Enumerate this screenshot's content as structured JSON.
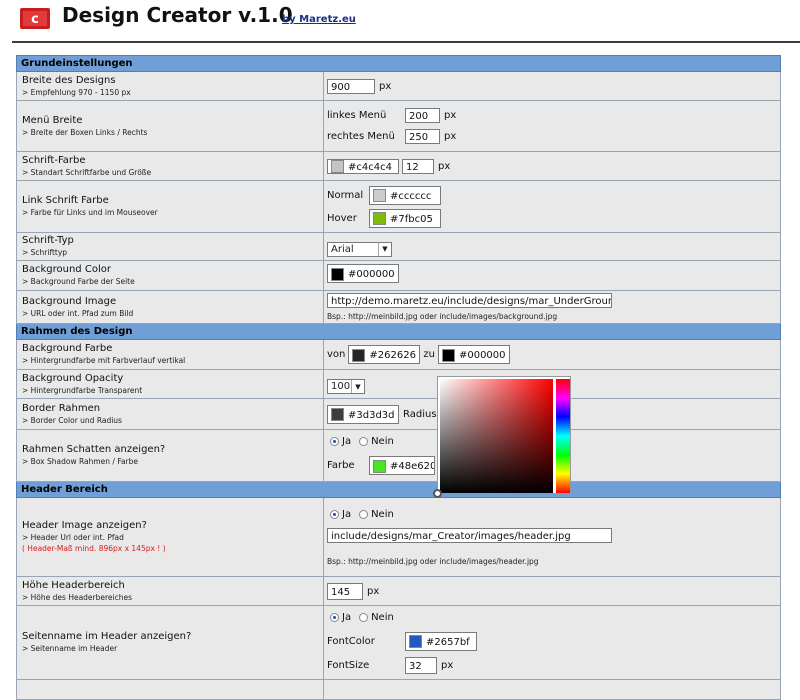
{
  "header": {
    "title": "Design Creator v.1.0",
    "byline": "by Maretz.eu"
  },
  "sections": {
    "basic": "Grundeinstellungen",
    "frame": "Rahmen des Design",
    "header": "Header Bereich"
  },
  "rows": {
    "width": {
      "label": "Breite des Designs",
      "sub": "> Empfehlung 970 - 1150 px",
      "value": "900",
      "unit": "px"
    },
    "menu": {
      "label": "Menü Breite",
      "sub": "> Breite der Boxen Links / Rechts",
      "left_label": "linkes Menü",
      "left_value": "200",
      "right_label": "rechtes Menü",
      "right_value": "250",
      "unit": "px"
    },
    "font_color": {
      "label": "Schrift-Farbe",
      "sub": "> Standart Schriftfarbe und Größe",
      "color": "#c4c4c4",
      "size": "12",
      "unit": "px"
    },
    "link_color": {
      "label": "Link Schrift Farbe",
      "sub": "> Farbe für Links und im Mouseover",
      "normal_label": "Normal",
      "normal_color": "#cccccc",
      "hover_label": "Hover",
      "hover_color": "#7fbc05"
    },
    "font_type": {
      "label": "Schrift-Typ",
      "sub": "> Schrifttyp",
      "value": "Arial"
    },
    "bg_color": {
      "label": "Background Color",
      "sub": "> Background Farbe der Seite",
      "color": "#000000"
    },
    "bg_image": {
      "label": "Background Image",
      "sub": "> URL oder int. Pfad zum Bild",
      "value": "http://demo.maretz.eu/include/designs/mar_UnderGround",
      "hint": "Bsp.: http://meinbild.jpg oder include/images/background.jpg"
    },
    "frame_bg": {
      "label": "Background Farbe",
      "sub": "> Hintergrundfarbe mit Farbverlauf vertikal",
      "from_label": "von",
      "from_color": "#262626",
      "to_label": "zu",
      "to_color": "#000000"
    },
    "frame_opacity": {
      "label": "Background Opacity",
      "sub": "> Hintergrundfarbe Transparent",
      "value": "100"
    },
    "border": {
      "label": "Border Rahmen",
      "sub": "> Border Color und Radius",
      "color": "#3d3d3d",
      "radius_label": "Radius"
    },
    "shadow": {
      "label": "Rahmen Schatten anzeigen?",
      "sub": "> Box Shadow Rahmen / Farbe",
      "yes": "Ja",
      "no": "Nein",
      "color_label": "Farbe",
      "color": "#48e620"
    },
    "header_image": {
      "label": "Header Image anzeigen?",
      "sub": "> Header Url oder int. Pfad",
      "warn": "( Header-Maß mind. 896px x 145px ! )",
      "yes": "Ja",
      "no": "Nein",
      "value": "include/designs/mar_Creator/images/header.jpg",
      "hint": "Bsp.: http://meinbild.jpg oder include/images/header.jpg"
    },
    "header_height": {
      "label": "Höhe Headerbereich",
      "sub": "> Höhe des Headerbereiches",
      "value": "145",
      "unit": "px"
    },
    "site_name": {
      "label": "Seitenname im Header anzeigen?",
      "sub": "> Seitenname im Header",
      "yes": "Ja",
      "no": "Nein",
      "font_color_label": "FontColor",
      "font_color": "#2657bf",
      "font_size_label": "FontSize",
      "font_size": "32",
      "unit": "px"
    }
  },
  "picker": {
    "hue": "#ff0000"
  }
}
